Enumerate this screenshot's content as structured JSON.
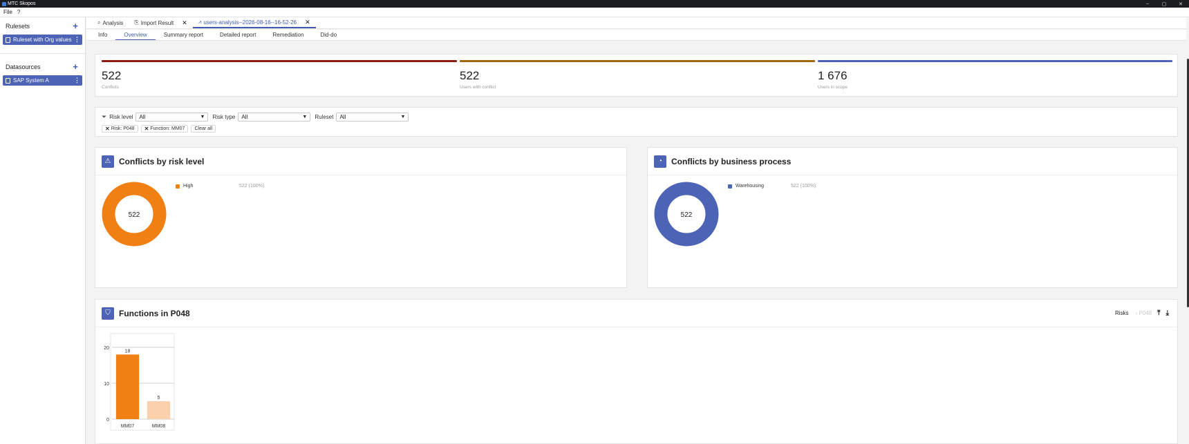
{
  "window": {
    "title": "MTC Skopos",
    "controls": [
      "–",
      "▢",
      "✕"
    ]
  },
  "menu": {
    "items": [
      "File",
      "?"
    ]
  },
  "sidebar": {
    "rulesets_title": "Rulesets",
    "rulesets": [
      {
        "label": "Ruleset with Org values"
      }
    ],
    "datasources_title": "Datasources",
    "datasources": [
      {
        "label": "SAP System A"
      }
    ]
  },
  "doc_tabs": [
    {
      "label": "Analysis",
      "icon": "search-icon"
    },
    {
      "label": "Import Result",
      "icon": "import-icon"
    },
    {
      "label": "users-analysis--2026-08-16--16-52-26",
      "icon": "chart-icon",
      "active": true
    }
  ],
  "view_tabs": [
    "Info",
    "Overview",
    "Summary report",
    "Detailed report",
    "Remediation",
    "Did-do"
  ],
  "active_view_tab": "Overview",
  "kpis": [
    {
      "value": "522",
      "label": "Conflicts",
      "color": "#8b1a14"
    },
    {
      "value": "522",
      "label": "Users with conflict",
      "color": "#a0660c"
    },
    {
      "value": "1 676",
      "label": "Users in scope",
      "color": "#4c63b6"
    }
  ],
  "filters": {
    "risk_level_label": "Risk level",
    "risk_level_value": "All",
    "risk_type_label": "Risk type",
    "risk_type_value": "All",
    "ruleset_label": "Ruleset",
    "ruleset_value": "All",
    "chips": [
      "Risk: P048",
      "Function: MM07"
    ],
    "clear_all": "Clear all"
  },
  "risk_level_card": {
    "title": "Conflicts by risk level",
    "center": "522",
    "legend": [
      {
        "name": "High",
        "value": "522 (100%)",
        "color": "#f07f14"
      }
    ]
  },
  "business_process_card": {
    "title": "Conflicts by business process",
    "center": "522",
    "legend": [
      {
        "name": "Warehousing",
        "value": "522 (100%)",
        "color": "#4c63b6"
      }
    ]
  },
  "functions_card": {
    "title": "Functions in P048",
    "nav_label": "Risks",
    "nav_crumb": "‹ P048"
  },
  "chart_data": {
    "type": "bar",
    "categories": [
      "MM07",
      "MM08"
    ],
    "values": [
      18,
      5
    ],
    "ylim": [
      0,
      20
    ],
    "yticks": [
      "0",
      "10",
      "20"
    ],
    "data_labels": [
      "18",
      "5"
    ],
    "colors": [
      "#f07f14",
      "#fbd1ad"
    ]
  }
}
